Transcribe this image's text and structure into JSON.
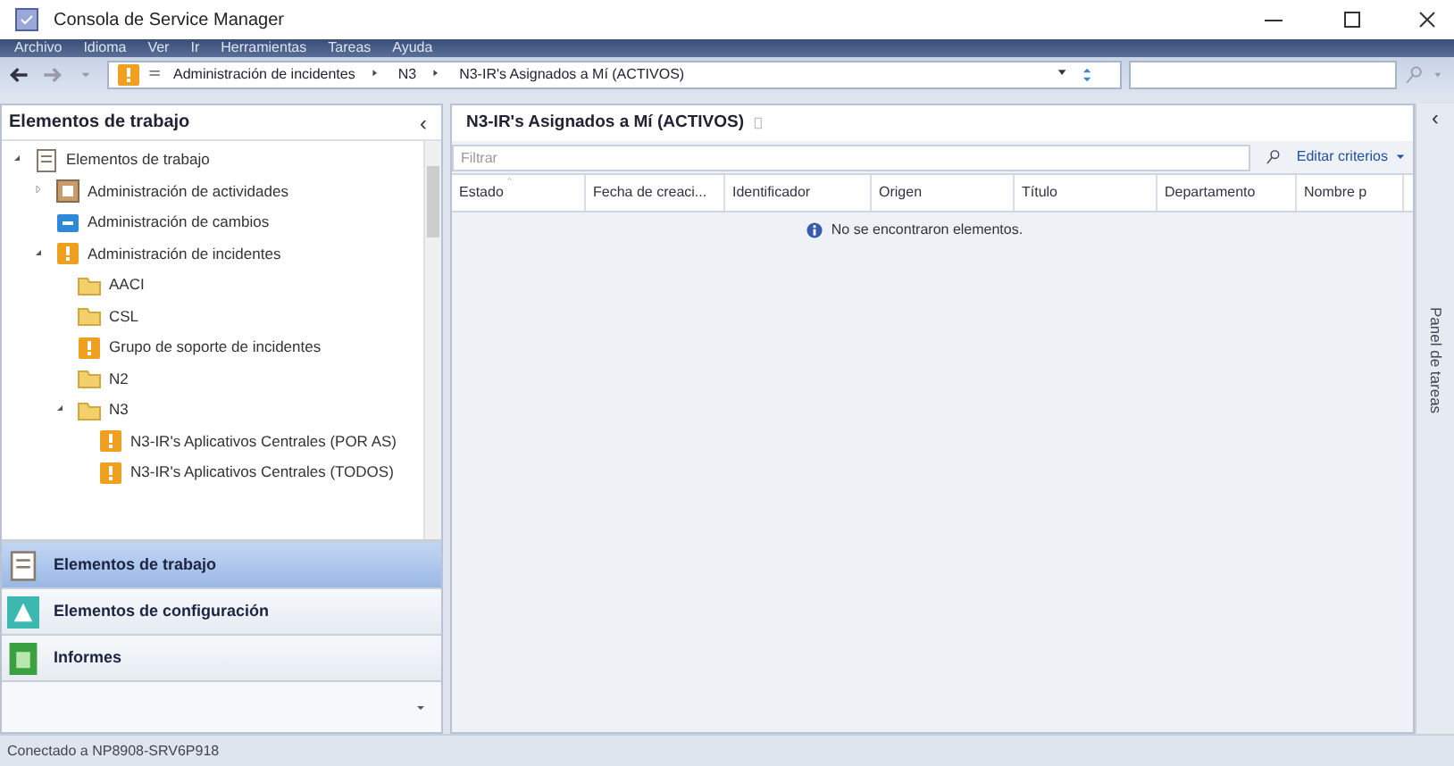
{
  "window": {
    "title": "Consola de Service Manager"
  },
  "menu": [
    "Archivo",
    "Idioma",
    "Ver",
    "Ir",
    "Herramientas",
    "Tareas",
    "Ayuda"
  ],
  "breadcrumb": [
    "Administración de incidentes",
    "N3",
    "N3-IR's Asignados a Mí (ACTIVOS)"
  ],
  "navigation_pane": {
    "title": "Elementos de trabajo",
    "collapse": "‹",
    "tree": [
      {
        "label": "Elementos de trabajo",
        "kind": "workitems",
        "expanded": true,
        "children": [
          {
            "label": "Administración de actividades",
            "kind": "activity",
            "expanded": false
          },
          {
            "label": "Administración de cambios",
            "kind": "change"
          },
          {
            "label": "Administración de incidentes",
            "kind": "incident",
            "expanded": true,
            "children": [
              {
                "label": "AACI",
                "kind": "folder"
              },
              {
                "label": "CSL",
                "kind": "folder"
              },
              {
                "label": "Grupo de soporte de incidentes",
                "kind": "incident"
              },
              {
                "label": "N2",
                "kind": "folder"
              },
              {
                "label": "N3",
                "kind": "folder",
                "expanded": true,
                "children": [
                  {
                    "label": "N3-IR's Aplicativos Centrales (POR AS)",
                    "kind": "incident"
                  },
                  {
                    "label": "N3-IR's Aplicativos Centrales (TODOS)",
                    "kind": "incident"
                  }
                ]
              }
            ]
          }
        ]
      }
    ],
    "workspaces": [
      {
        "label": "Elementos de trabajo",
        "kind": "workitems",
        "selected": true
      },
      {
        "label": "Elementos de configuración",
        "kind": "config",
        "selected": false
      },
      {
        "label": "Informes",
        "kind": "reports",
        "selected": false
      }
    ]
  },
  "view": {
    "title": "N3-IR's Asignados a Mí (ACTIVOS)",
    "filter_placeholder": "Filtrar",
    "edit_criteria": "Editar criterios",
    "columns": [
      "Estado",
      "Fecha de creaci...",
      "Identificador",
      "Origen",
      "Título",
      "Departamento",
      "Nombre p"
    ],
    "empty_message": "No se encontraron elementos."
  },
  "task_pane": {
    "label": "Panel de tareas",
    "collapse": "‹"
  },
  "status_bar": "Conectado a NP8908-SRV6P918"
}
